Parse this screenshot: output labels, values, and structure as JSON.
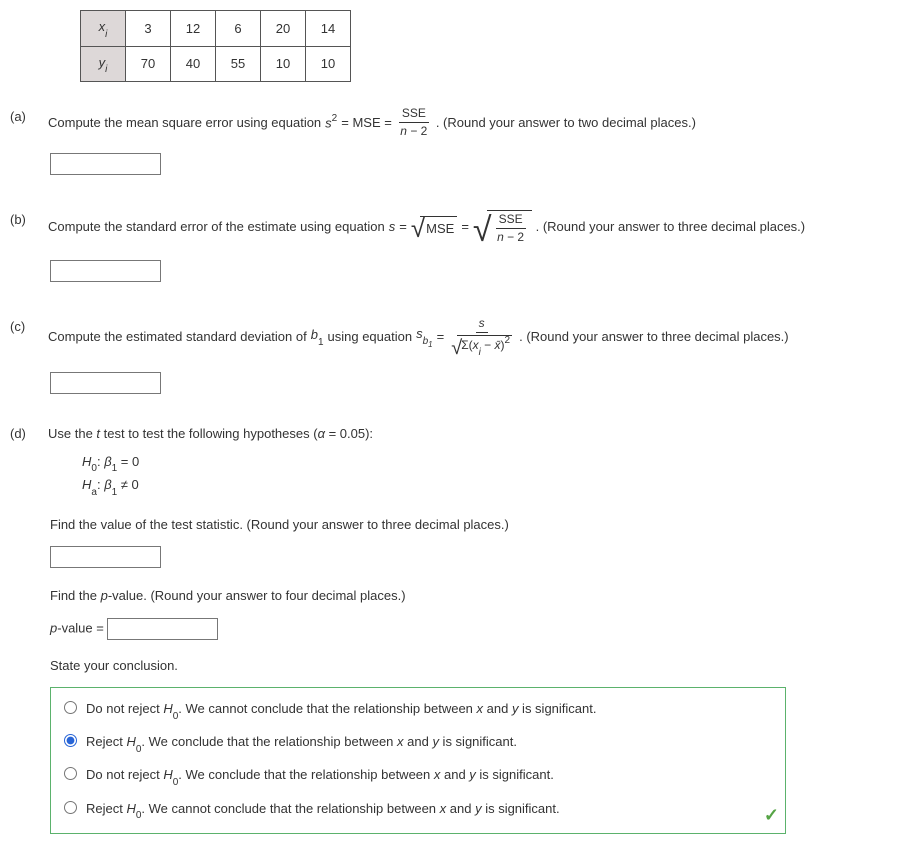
{
  "table": {
    "xlabel": "x",
    "xlabel_sub": "i",
    "ylabel": "y",
    "ylabel_sub": "i",
    "x": [
      "3",
      "12",
      "6",
      "20",
      "14"
    ],
    "y": [
      "70",
      "40",
      "55",
      "10",
      "10"
    ]
  },
  "parts": {
    "a": {
      "label": "(a)",
      "text1": "Compute the mean square error using equation ",
      "sym_s": "s",
      "sup2": "2",
      "eq_mse": " = MSE = ",
      "frac_num": "SSE",
      "frac_den_n": "n",
      "frac_den_rest": " − 2",
      "after": ". (Round your answer to two decimal places.)"
    },
    "b": {
      "label": "(b)",
      "text1": "Compute the standard error of the estimate using equation ",
      "sym_s": "s",
      "eq": " = ",
      "under_root1": "MSE",
      "eq2": " = ",
      "frac_num": "SSE",
      "frac_den_n": "n",
      "frac_den_rest": " − 2",
      "after": ". (Round your answer to three decimal places.)"
    },
    "c": {
      "label": "(c)",
      "text1": "Compute the estimated standard deviation of ",
      "b": "b",
      "b_sub": "1",
      "text2": " using equation ",
      "s": "s",
      "sb": "b",
      "sb_sub": "1",
      "eq": " = ",
      "frac_num_s": "s",
      "den_sigma": "Σ(",
      "den_x": "x",
      "den_i": "i",
      "den_mid": " − ",
      "den_xbar": "x̄",
      "den_close": ")",
      "den_sq": "2",
      "after": ". (Round your answer to three decimal places.)"
    },
    "d": {
      "label": "(d)",
      "text1": "Use the ",
      "t": "t",
      "text2": " test to test the following hypotheses (",
      "alpha": "α",
      "text3": " = 0.05):",
      "hyp_h0": "H",
      "hyp_0sub": "0",
      "hyp_colon": ": ",
      "beta": "β",
      "beta_sub": "1",
      "hyp_h0_rest": " = 0",
      "hyp_ha": "H",
      "hyp_asub": "a",
      "hyp_ha_rest": " ≠ 0",
      "find_stat": "Find the value of the test statistic. (Round your answer to three decimal places.)",
      "find_p": "Find the ",
      "p_ital": "p",
      "find_p2": "-value. (Round your answer to four decimal places.)",
      "pval_label_p": "p",
      "pval_label_rest": "-value = ",
      "state": "State your conclusion.",
      "opts": {
        "o1a": "Do not reject ",
        "H": "H",
        "Hsub": "0",
        "o1b": ". We cannot conclude that the relationship between ",
        "x": "x",
        "and": " and ",
        "y": "y",
        "o1c": " is significant.",
        "o2a": "Reject ",
        "o2b": ". We conclude that the relationship between ",
        "o2c": " is significant.",
        "o3a": "Do not reject ",
        "o3b": ". We conclude that the relationship between ",
        "o3c": " is significant.",
        "o4a": "Reject ",
        "o4b": ". We cannot conclude that the relationship between ",
        "o4c": " is significant."
      }
    }
  }
}
